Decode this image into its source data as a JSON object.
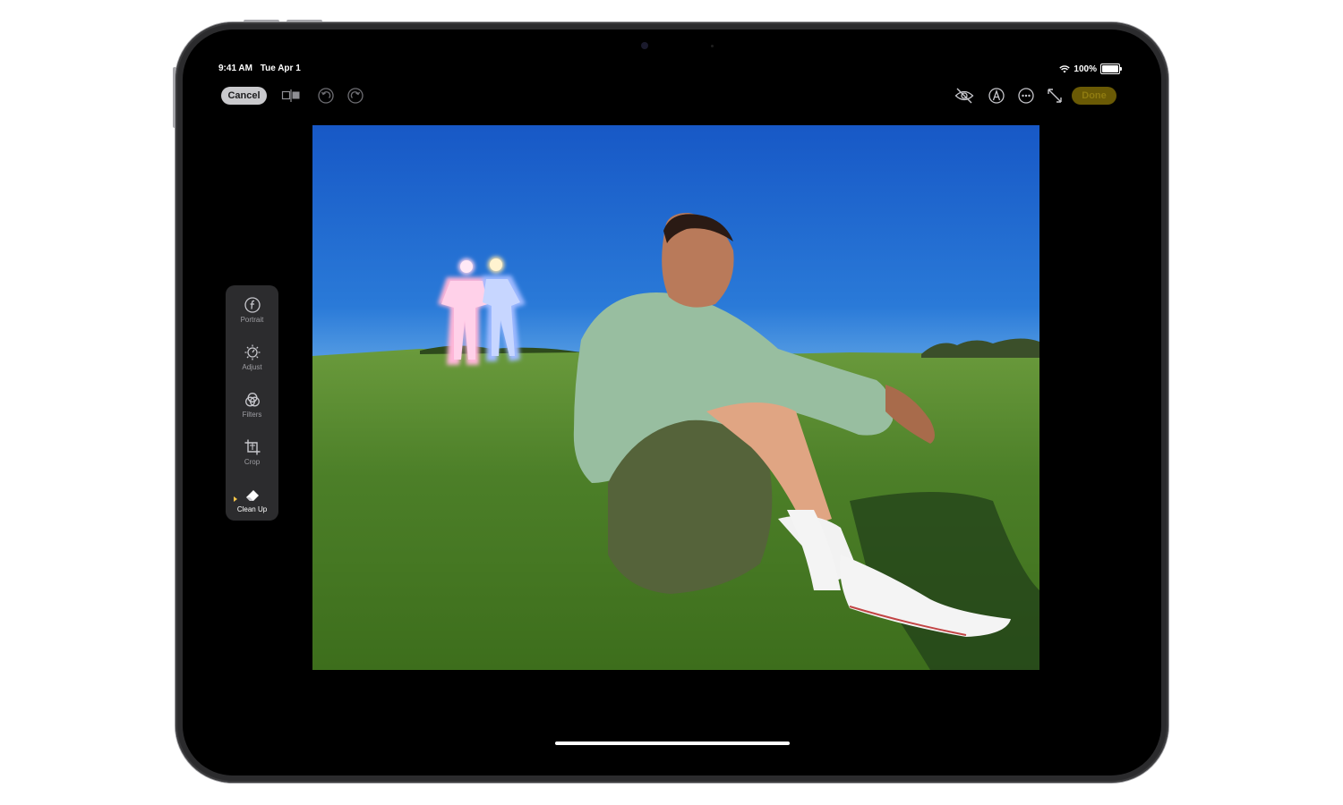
{
  "status_bar": {
    "time": "9:41 AM",
    "date": "Tue Apr 1",
    "battery": "100%"
  },
  "toolbar": {
    "cancel_label": "Cancel",
    "done_label": "Done",
    "icons": [
      "compare-icon",
      "undo-icon",
      "redo-icon",
      "hide-icon",
      "markup-icon",
      "more-icon",
      "expand-icon"
    ]
  },
  "sidebar": {
    "items": [
      {
        "label": "Portrait",
        "icon": "aperture-f-icon"
      },
      {
        "label": "Adjust",
        "icon": "adjust-dial-icon"
      },
      {
        "label": "Filters",
        "icon": "filters-icon"
      },
      {
        "label": "Crop",
        "icon": "crop-icon"
      },
      {
        "label": "Clean Up",
        "icon": "eraser-icon",
        "active": true
      }
    ]
  },
  "colors": {
    "accent": "#f7c548",
    "done_bg": "#6a5a05",
    "sky": "#1f64c9",
    "grass": "#4a7d25"
  }
}
